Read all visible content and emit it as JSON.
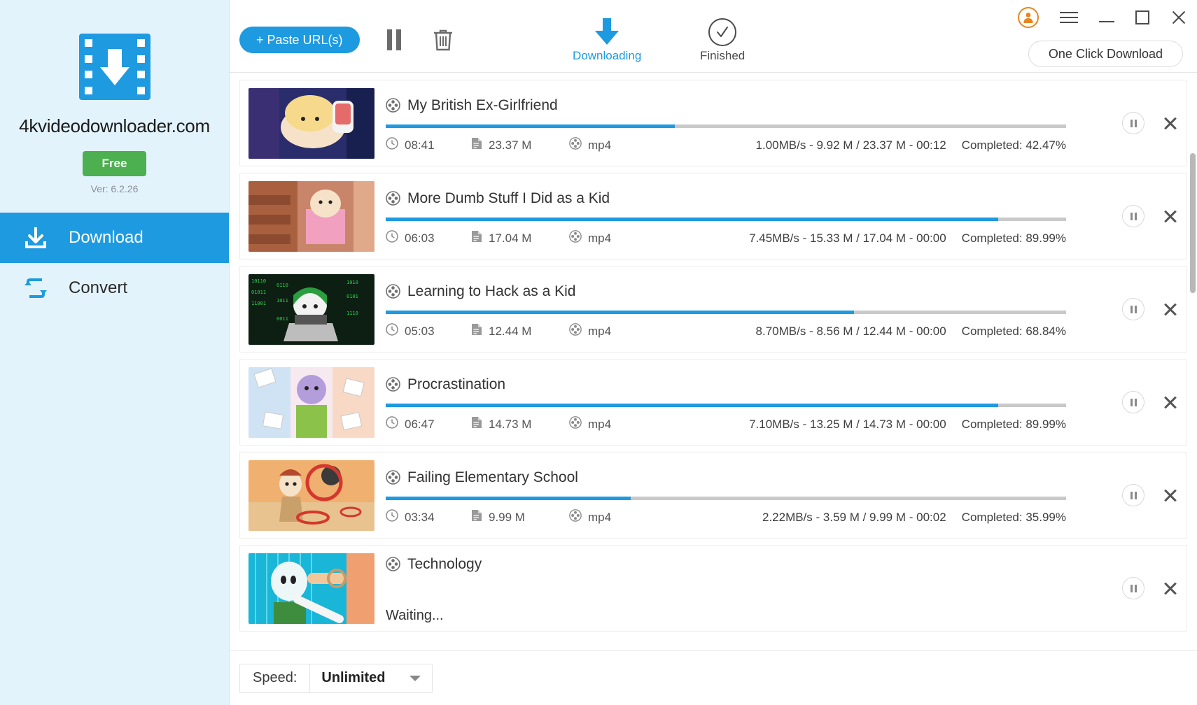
{
  "sidebar": {
    "brand": "4kvideodownloader.com",
    "badge": "Free",
    "version": "Ver: 6.2.26",
    "items": [
      {
        "label": "Download",
        "icon": "download-icon",
        "active": true
      },
      {
        "label": "Convert",
        "icon": "convert-icon",
        "active": false
      }
    ]
  },
  "toolbar": {
    "paste_button": "+ Paste URL(s)",
    "pause_all_icon": "pause-icon",
    "delete_icon": "trash-icon",
    "tabs": [
      {
        "label": "Downloading",
        "icon": "download-arrow-icon",
        "active": true
      },
      {
        "label": "Finished",
        "icon": "check-circle-icon",
        "active": false
      }
    ],
    "one_click_download": "One Click Download",
    "account_icon": "account-icon",
    "menu_icon": "hamburger-menu-icon",
    "minimize_icon": "minimize-icon",
    "maximize_icon": "maximize-icon",
    "close_icon": "close-icon"
  },
  "downloads": [
    {
      "title": "My British Ex-Girlfriend",
      "duration": "08:41",
      "size": "23.37 M",
      "format": "mp4",
      "stats": "1.00MB/s - 9.92 M / 23.37 M - 00:12",
      "completed": "Completed: 42.47%",
      "progress": 42.47,
      "status": "downloading"
    },
    {
      "title": "More Dumb Stuff I Did as a Kid",
      "duration": "06:03",
      "size": "17.04 M",
      "format": "mp4",
      "stats": "7.45MB/s - 15.33 M / 17.04 M - 00:00",
      "completed": "Completed: 89.99%",
      "progress": 89.99,
      "status": "downloading"
    },
    {
      "title": "Learning to Hack as a Kid",
      "duration": "05:03",
      "size": "12.44 M",
      "format": "mp4",
      "stats": "8.70MB/s - 8.56 M / 12.44 M - 00:00",
      "completed": "Completed: 68.84%",
      "progress": 68.84,
      "status": "downloading"
    },
    {
      "title": "Procrastination",
      "duration": "06:47",
      "size": "14.73 M",
      "format": "mp4",
      "stats": "7.10MB/s - 13.25 M / 14.73 M - 00:00",
      "completed": "Completed: 89.99%",
      "progress": 89.99,
      "status": "downloading"
    },
    {
      "title": "Failing Elementary School",
      "duration": "03:34",
      "size": "9.99 M",
      "format": "mp4",
      "stats": "2.22MB/s - 3.59 M / 9.99 M - 00:02",
      "completed": "Completed: 35.99%",
      "progress": 35.99,
      "status": "downloading"
    },
    {
      "title": "Technology",
      "duration": "",
      "size": "",
      "format": "",
      "stats": "",
      "completed": "",
      "progress": 0,
      "status": "Waiting..."
    }
  ],
  "bottom": {
    "speed_label": "Speed:",
    "speed_value": "Unlimited",
    "caret_icon": "chevron-down-icon"
  },
  "colors": {
    "accent": "#1e9ae0",
    "sidebar_bg": "#e3f3fc",
    "free_badge": "#4caf50",
    "account_outline": "#e8851f",
    "progress_track": "#c9c9c9"
  }
}
